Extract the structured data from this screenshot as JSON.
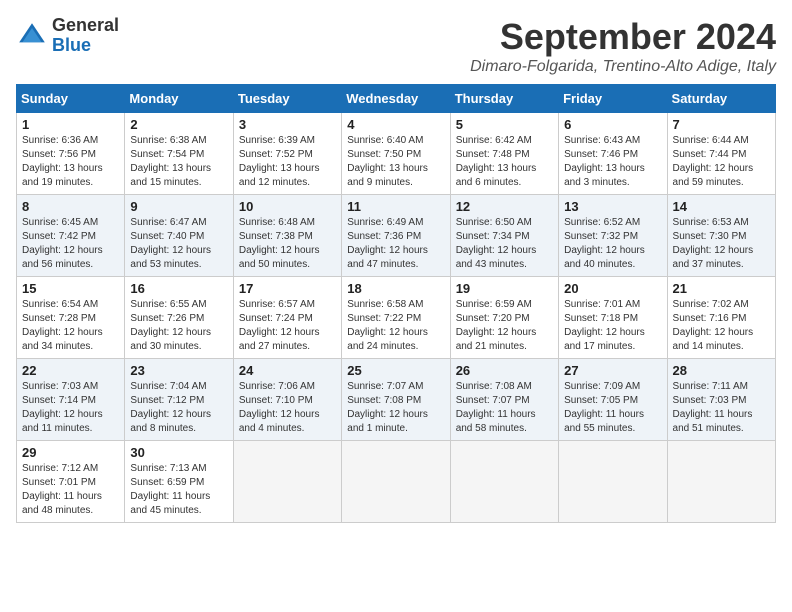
{
  "header": {
    "logo_general": "General",
    "logo_blue": "Blue",
    "month_title": "September 2024",
    "location": "Dimaro-Folgarida, Trentino-Alto Adige, Italy"
  },
  "days_of_week": [
    "Sunday",
    "Monday",
    "Tuesday",
    "Wednesday",
    "Thursday",
    "Friday",
    "Saturday"
  ],
  "weeks": [
    [
      {
        "day": "1",
        "info": "Sunrise: 6:36 AM\nSunset: 7:56 PM\nDaylight: 13 hours\nand 19 minutes."
      },
      {
        "day": "2",
        "info": "Sunrise: 6:38 AM\nSunset: 7:54 PM\nDaylight: 13 hours\nand 15 minutes."
      },
      {
        "day": "3",
        "info": "Sunrise: 6:39 AM\nSunset: 7:52 PM\nDaylight: 13 hours\nand 12 minutes."
      },
      {
        "day": "4",
        "info": "Sunrise: 6:40 AM\nSunset: 7:50 PM\nDaylight: 13 hours\nand 9 minutes."
      },
      {
        "day": "5",
        "info": "Sunrise: 6:42 AM\nSunset: 7:48 PM\nDaylight: 13 hours\nand 6 minutes."
      },
      {
        "day": "6",
        "info": "Sunrise: 6:43 AM\nSunset: 7:46 PM\nDaylight: 13 hours\nand 3 minutes."
      },
      {
        "day": "7",
        "info": "Sunrise: 6:44 AM\nSunset: 7:44 PM\nDaylight: 12 hours\nand 59 minutes."
      }
    ],
    [
      {
        "day": "8",
        "info": "Sunrise: 6:45 AM\nSunset: 7:42 PM\nDaylight: 12 hours\nand 56 minutes."
      },
      {
        "day": "9",
        "info": "Sunrise: 6:47 AM\nSunset: 7:40 PM\nDaylight: 12 hours\nand 53 minutes."
      },
      {
        "day": "10",
        "info": "Sunrise: 6:48 AM\nSunset: 7:38 PM\nDaylight: 12 hours\nand 50 minutes."
      },
      {
        "day": "11",
        "info": "Sunrise: 6:49 AM\nSunset: 7:36 PM\nDaylight: 12 hours\nand 47 minutes."
      },
      {
        "day": "12",
        "info": "Sunrise: 6:50 AM\nSunset: 7:34 PM\nDaylight: 12 hours\nand 43 minutes."
      },
      {
        "day": "13",
        "info": "Sunrise: 6:52 AM\nSunset: 7:32 PM\nDaylight: 12 hours\nand 40 minutes."
      },
      {
        "day": "14",
        "info": "Sunrise: 6:53 AM\nSunset: 7:30 PM\nDaylight: 12 hours\nand 37 minutes."
      }
    ],
    [
      {
        "day": "15",
        "info": "Sunrise: 6:54 AM\nSunset: 7:28 PM\nDaylight: 12 hours\nand 34 minutes."
      },
      {
        "day": "16",
        "info": "Sunrise: 6:55 AM\nSunset: 7:26 PM\nDaylight: 12 hours\nand 30 minutes."
      },
      {
        "day": "17",
        "info": "Sunrise: 6:57 AM\nSunset: 7:24 PM\nDaylight: 12 hours\nand 27 minutes."
      },
      {
        "day": "18",
        "info": "Sunrise: 6:58 AM\nSunset: 7:22 PM\nDaylight: 12 hours\nand 24 minutes."
      },
      {
        "day": "19",
        "info": "Sunrise: 6:59 AM\nSunset: 7:20 PM\nDaylight: 12 hours\nand 21 minutes."
      },
      {
        "day": "20",
        "info": "Sunrise: 7:01 AM\nSunset: 7:18 PM\nDaylight: 12 hours\nand 17 minutes."
      },
      {
        "day": "21",
        "info": "Sunrise: 7:02 AM\nSunset: 7:16 PM\nDaylight: 12 hours\nand 14 minutes."
      }
    ],
    [
      {
        "day": "22",
        "info": "Sunrise: 7:03 AM\nSunset: 7:14 PM\nDaylight: 12 hours\nand 11 minutes."
      },
      {
        "day": "23",
        "info": "Sunrise: 7:04 AM\nSunset: 7:12 PM\nDaylight: 12 hours\nand 8 minutes."
      },
      {
        "day": "24",
        "info": "Sunrise: 7:06 AM\nSunset: 7:10 PM\nDaylight: 12 hours\nand 4 minutes."
      },
      {
        "day": "25",
        "info": "Sunrise: 7:07 AM\nSunset: 7:08 PM\nDaylight: 12 hours\nand 1 minute."
      },
      {
        "day": "26",
        "info": "Sunrise: 7:08 AM\nSunset: 7:07 PM\nDaylight: 11 hours\nand 58 minutes."
      },
      {
        "day": "27",
        "info": "Sunrise: 7:09 AM\nSunset: 7:05 PM\nDaylight: 11 hours\nand 55 minutes."
      },
      {
        "day": "28",
        "info": "Sunrise: 7:11 AM\nSunset: 7:03 PM\nDaylight: 11 hours\nand 51 minutes."
      }
    ],
    [
      {
        "day": "29",
        "info": "Sunrise: 7:12 AM\nSunset: 7:01 PM\nDaylight: 11 hours\nand 48 minutes."
      },
      {
        "day": "30",
        "info": "Sunrise: 7:13 AM\nSunset: 6:59 PM\nDaylight: 11 hours\nand 45 minutes."
      },
      {
        "day": "",
        "info": ""
      },
      {
        "day": "",
        "info": ""
      },
      {
        "day": "",
        "info": ""
      },
      {
        "day": "",
        "info": ""
      },
      {
        "day": "",
        "info": ""
      }
    ]
  ]
}
